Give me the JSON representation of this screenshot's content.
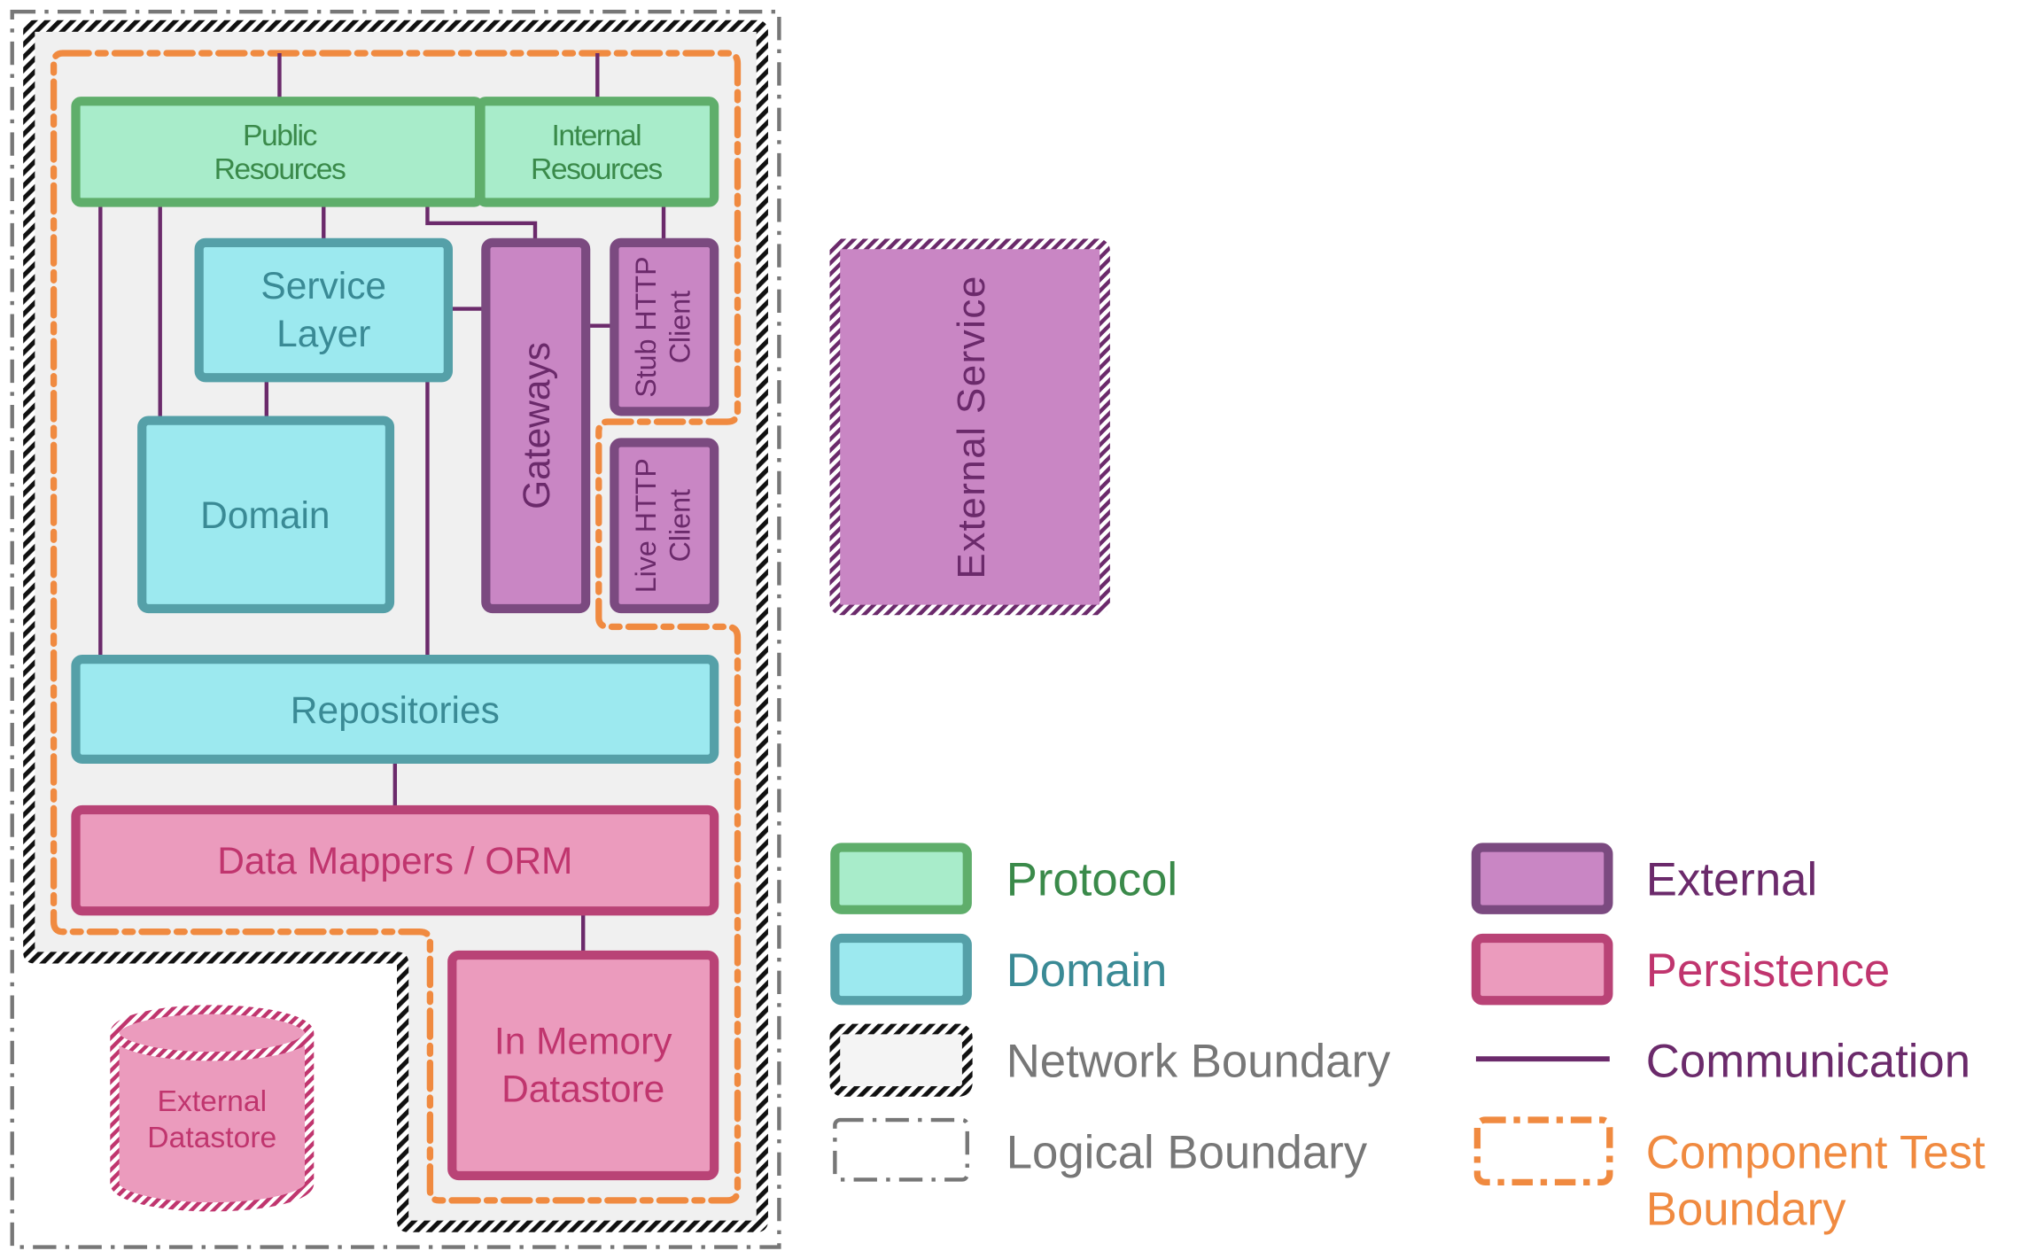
{
  "colors": {
    "protocol_fill": "#a8ecca",
    "protocol_stroke": "#5fae6b",
    "protocol_text": "#3a8a4a",
    "domain_fill": "#9ce9ef",
    "domain_stroke": "#55a0a8",
    "domain_text": "#3a8a95",
    "external_fill": "#c986c4",
    "external_stroke": "#7b4a80",
    "external_text": "#6b2a6b",
    "persistence_fill": "#eb9bbd",
    "persistence_stroke": "#b94376",
    "persistence_text": "#c0356e",
    "communication": "#6b2a6b",
    "component_boundary": "#f08a40",
    "logical_boundary": "#777777",
    "network_fill": "#f0f0f0"
  },
  "nodes": {
    "public_resources": [
      "Public",
      "Resources"
    ],
    "internal_resources": [
      "Internal",
      "Resources"
    ],
    "service_layer": [
      "Service",
      "Layer"
    ],
    "domain": "Domain",
    "gateways": "Gateways",
    "stub_http_client": [
      "Stub HTTP",
      "Client"
    ],
    "live_http_client": [
      "Live HTTP",
      "Client"
    ],
    "repositories": "Repositories",
    "data_mappers": "Data Mappers / ORM",
    "in_memory_datastore": [
      "In Memory",
      "Datastore"
    ],
    "external_datastore": [
      "External",
      "Datastore"
    ],
    "external_service": "External Service"
  },
  "legend": {
    "protocol": "Protocol",
    "domain": "Domain",
    "network_boundary": "Network Boundary",
    "logical_boundary": "Logical Boundary",
    "external": "External",
    "persistence": "Persistence",
    "communication": "Communication",
    "component_test_boundary": [
      "Component Test",
      "Boundary"
    ]
  }
}
